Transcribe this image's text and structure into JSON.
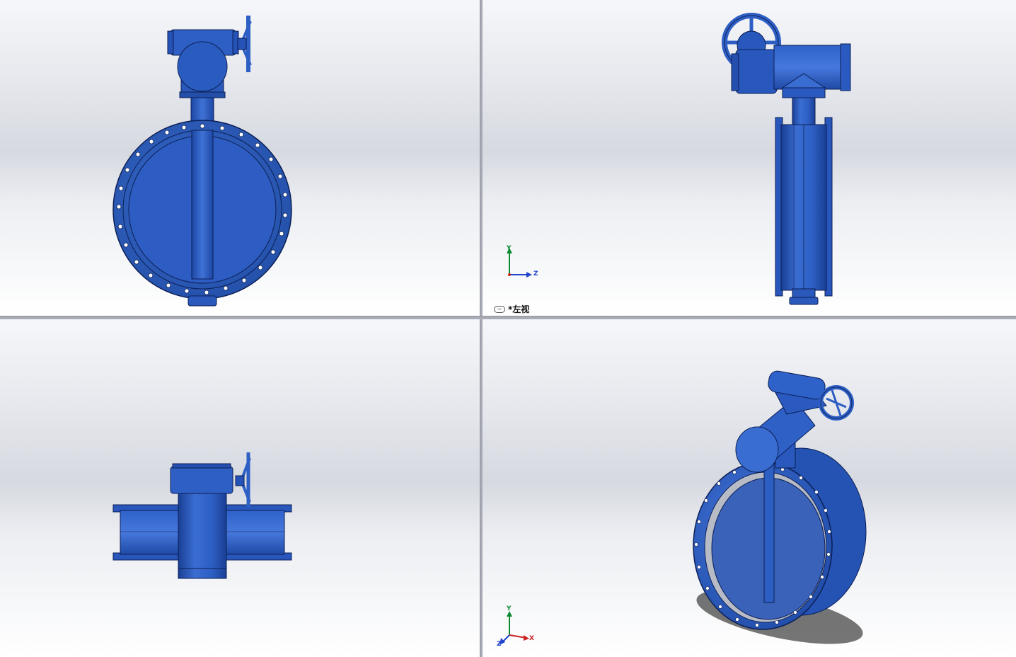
{
  "views": {
    "top_left": {
      "name": "front"
    },
    "top_right": {
      "name": "left",
      "label": "*左视"
    },
    "bottom_left": {
      "name": "top"
    },
    "bottom_right": {
      "name": "isometric"
    }
  },
  "triad": {
    "y": "Y",
    "z": "Z",
    "x": "X"
  },
  "colors": {
    "part": "#2f5fbf",
    "part_dark": "#1a3f94",
    "part_light": "#4d7ee0",
    "edge": "#0c1f55",
    "background_top": "#f6f7fa",
    "background_mid": "#d6d9e0"
  }
}
